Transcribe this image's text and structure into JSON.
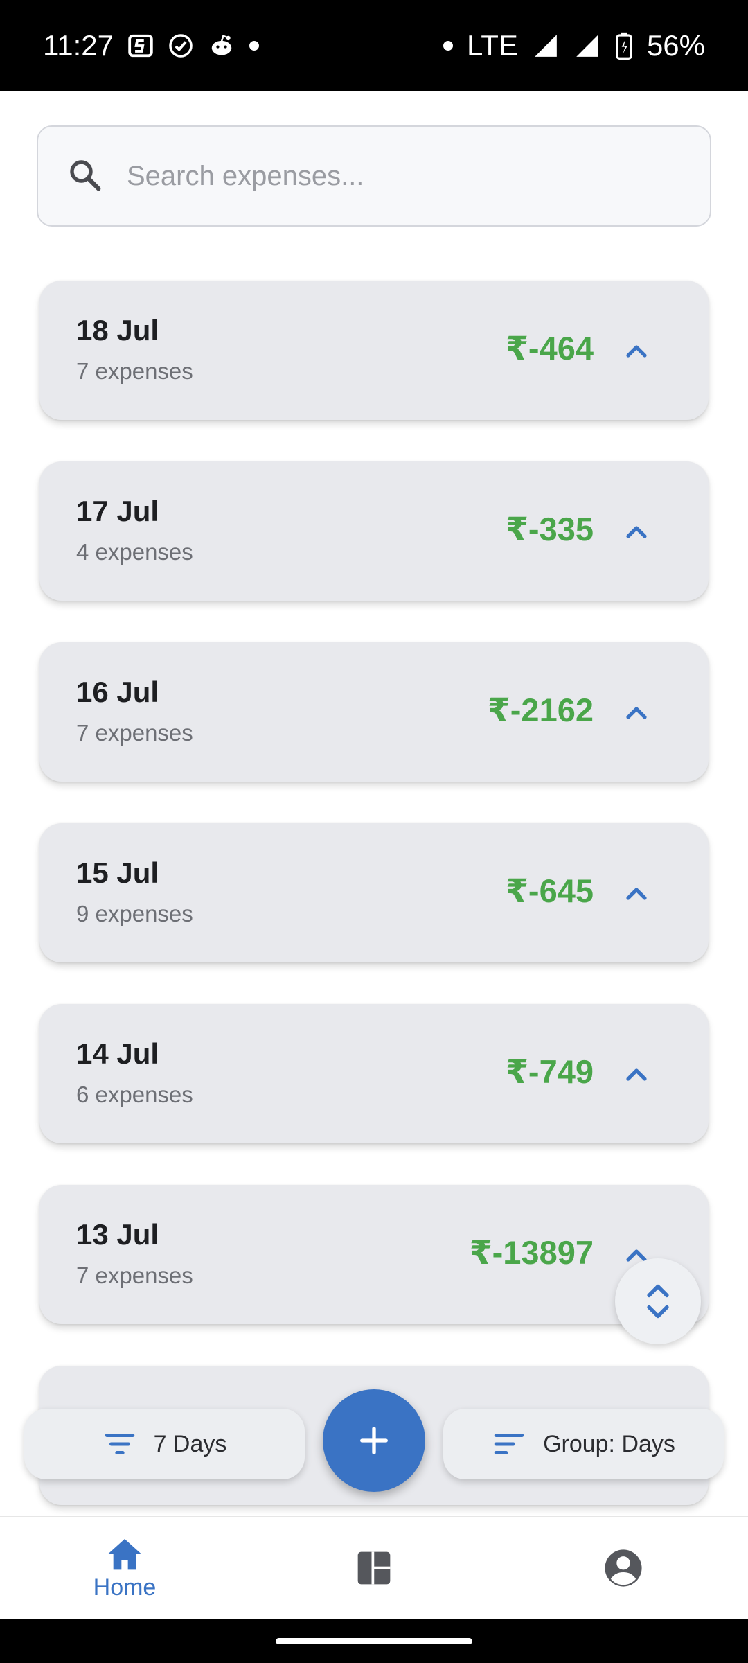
{
  "status_bar": {
    "time": "11:27",
    "network": "LTE",
    "battery": "56%"
  },
  "search": {
    "placeholder": "Search expenses..."
  },
  "groups": [
    {
      "date": "18 Jul",
      "count": "7 expenses",
      "amount": "₹-464"
    },
    {
      "date": "17 Jul",
      "count": "4 expenses",
      "amount": "₹-335"
    },
    {
      "date": "16 Jul",
      "count": "7 expenses",
      "amount": "₹-2162"
    },
    {
      "date": "15 Jul",
      "count": "9 expenses",
      "amount": "₹-645"
    },
    {
      "date": "14 Jul",
      "count": "6 expenses",
      "amount": "₹-749"
    },
    {
      "date": "13 Jul",
      "count": "7 expenses",
      "amount": "₹-13897"
    }
  ],
  "filters": {
    "period_label": "7 Days",
    "group_label": "Group: Days"
  },
  "bottom_nav": {
    "home_label": "Home"
  },
  "colors": {
    "accent": "#3a73c4",
    "amount": "#4aa64a",
    "card": "#e8e9ed"
  }
}
